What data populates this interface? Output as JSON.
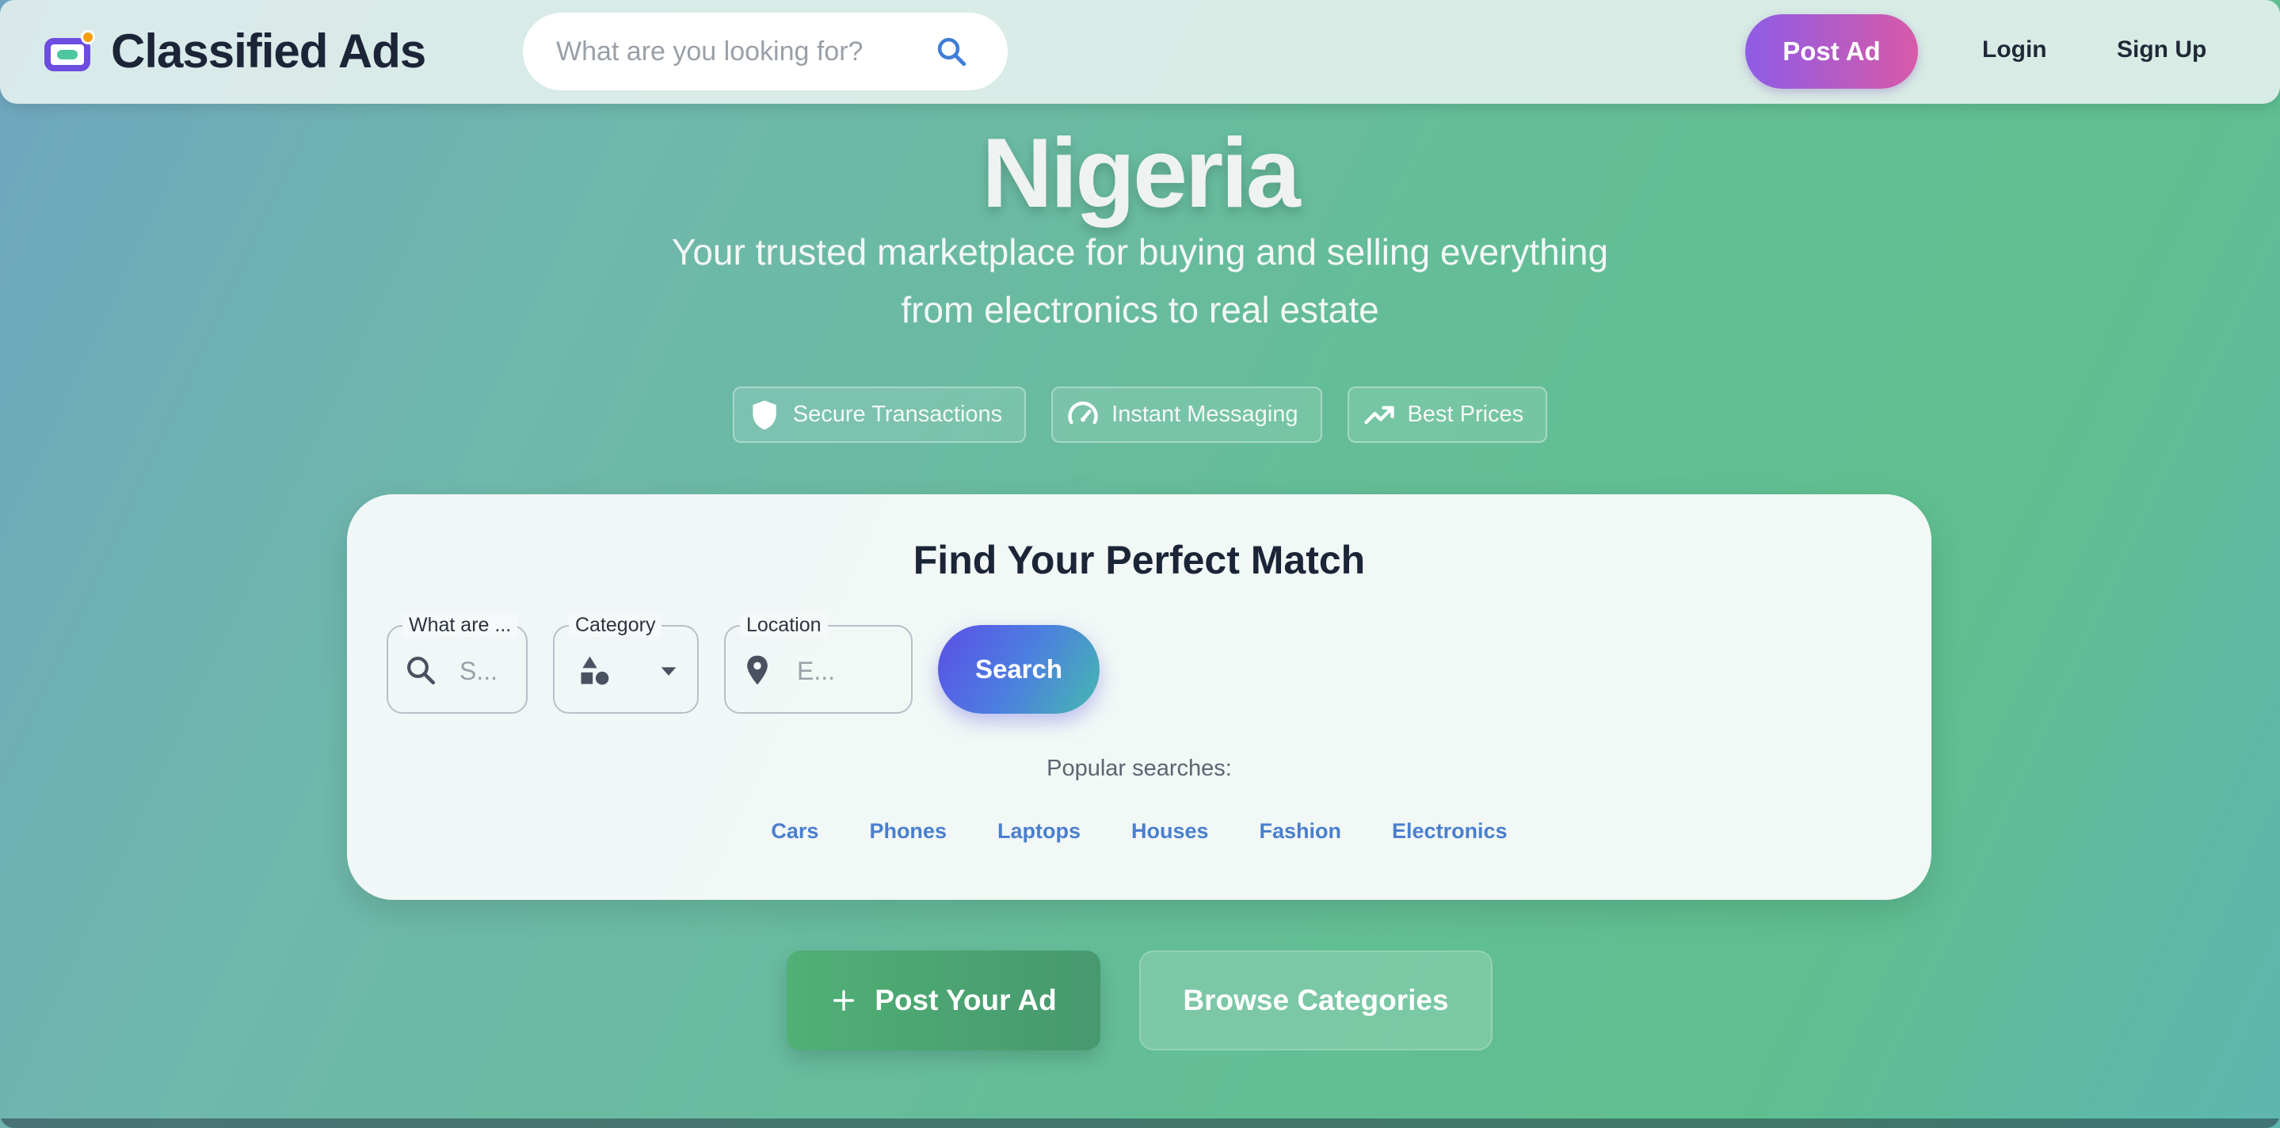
{
  "header": {
    "logo_text": "Classified Ads",
    "search_placeholder": "What are you looking for?",
    "post_ad_label": "Post Ad",
    "login_label": "Login",
    "signup_label": "Sign Up"
  },
  "hero": {
    "title": "Nigeria",
    "subtitle_line1": "Your trusted marketplace for buying and selling everything",
    "subtitle_line2": "from electronics to real estate",
    "features": [
      {
        "label": "Secure Transactions",
        "icon": "shield-icon"
      },
      {
        "label": "Instant Messaging",
        "icon": "speedometer-icon"
      },
      {
        "label": "Best Prices",
        "icon": "trending-up-icon"
      }
    ]
  },
  "search_card": {
    "title": "Find Your Perfect Match",
    "what_legend": "What are ...",
    "what_placeholder": "S...",
    "category_legend": "Category",
    "location_legend": "Location",
    "location_placeholder": "E...",
    "search_label": "Search",
    "popular_label": "Popular searches:",
    "popular": [
      "Cars",
      "Phones",
      "Laptops",
      "Houses",
      "Fashion",
      "Electronics"
    ]
  },
  "cta": {
    "post_label": "Post Your Ad",
    "browse_label": "Browse Categories"
  },
  "colors": {
    "accent_purple": "#8d5ce6",
    "accent_pink": "#d85aa8",
    "link_blue": "#4a7fce",
    "green": "#50b075"
  }
}
